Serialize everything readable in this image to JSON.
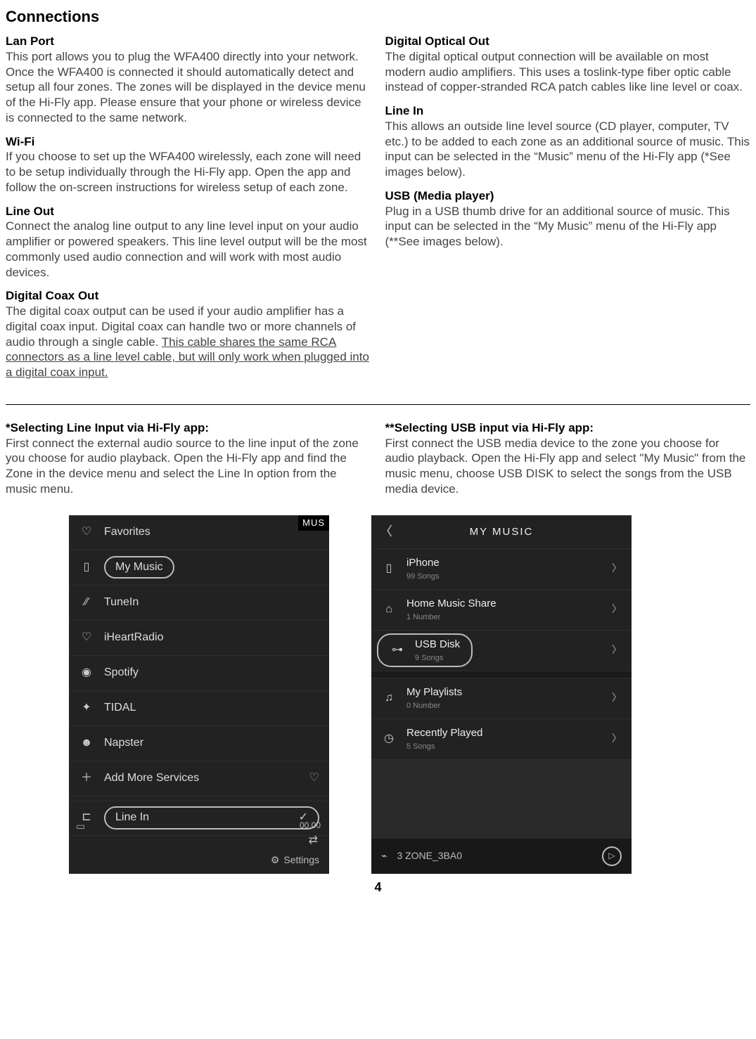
{
  "title": "Connections",
  "page_number": "4",
  "left_sections": [
    {
      "title": "Lan Port",
      "body": "This port allows you to plug the WFA400 directly into your network. Once the WFA400 is connected it should automatically detect and setup all four zones. The zones will be displayed in the device menu of the Hi-Fly app. Please ensure that your phone or wireless device is connected to the same network."
    },
    {
      "title": "Wi-Fi",
      "body": "If you choose to set up the WFA400 wirelessly, each zone will need to be setup individually through the Hi-Fly app. Open the app and follow the on-screen instructions for wireless setup of each zone."
    },
    {
      "title": "Line Out",
      "body": "Connect the analog line output to any line level input on your audio amplifier or powered speakers. This line level output will be the most commonly used audio connection and will work with most audio devices."
    },
    {
      "title": "Digital Coax Out",
      "body_pre": "The digital coax output can be used if your audio amplifier has a digital coax input. Digital coax can handle two or more channels of audio through a single cable. ",
      "body_underline": "This cable shares the same RCA connectors as a line level cable, but will only work when plugged into a digital coax input."
    }
  ],
  "right_sections": [
    {
      "title": "Digital Optical Out",
      "body": "The digital optical output connection will be available on most modern audio amplifiers. This uses a toslink-type fiber optic cable instead of copper-stranded RCA patch cables like line level or coax."
    },
    {
      "title": "Line In",
      "body": "This allows an outside line level source (CD player, computer, TV etc.) to be added to each zone as an additional source of music. This input can be selected in the “Music” menu of the Hi-Fly app (*See images below)."
    },
    {
      "title": "USB (Media player)",
      "body": "Plug in a USB thumb drive for an additional source of music. This input can be selected in the “My Music” menu of the Hi-Fly app (**See images below)."
    }
  ],
  "instructions": {
    "left": {
      "title": "*Selecting Line Input via Hi-Fly app:",
      "body": "First connect the external audio source to the line input of the zone you choose for audio playback. Open the Hi-Fly app and find the Zone in the device menu and select the Line In option from the music menu."
    },
    "right": {
      "title": "**Selecting USB input via Hi-Fly app:",
      "body": "First connect the USB media device to the zone you choose for audio playback. Open the Hi-Fly app and select \"My Music\" from the music menu, choose USB DISK to select the songs from the USB media device."
    }
  },
  "phoneA": {
    "topcut": "MUS",
    "rows": {
      "favorites": "Favorites",
      "mymusic": "My Music",
      "tunein": "TuneIn",
      "iheart": "iHeartRadio",
      "spotify": "Spotify",
      "tidal": "TIDAL",
      "napster": "Napster",
      "addmore": "Add More Services",
      "linein": "Line In"
    },
    "time": "00.00",
    "settings": "Settings"
  },
  "phoneB": {
    "header": "MY MUSIC",
    "items": {
      "iphone": {
        "main": "iPhone",
        "sub": "99 Songs"
      },
      "homeshare": {
        "main": "Home Music Share",
        "sub": "1 Number"
      },
      "usbdisk": {
        "main": "USB Disk",
        "sub": "9 Songs"
      },
      "playlists": {
        "main": "My Playlists",
        "sub": "0 Number"
      },
      "recent": {
        "main": "Recently Played",
        "sub": "5 Songs"
      }
    },
    "footer": "3 ZONE_3BA0"
  }
}
